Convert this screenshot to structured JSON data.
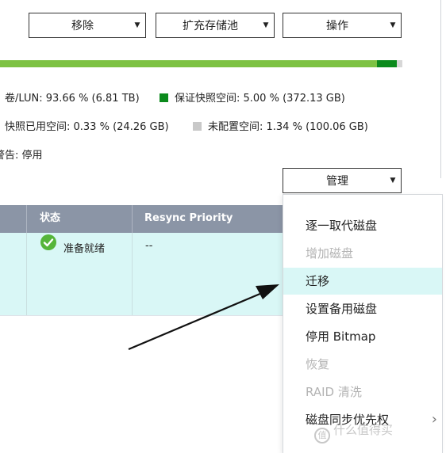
{
  "toolbar": {
    "remove_label": "移除",
    "expand_label": "扩充存储池",
    "actions_label": "操作"
  },
  "usage_bar": {
    "used_fraction": 0.9366,
    "snapshot_fraction": 0.05,
    "colors": {
      "used": "#7dc243",
      "snapshot": "#0b8a1c",
      "free": "#d7d7d7"
    }
  },
  "stats": {
    "volume_lun": "卷/LUN: 93.66 % (6.81 TB)",
    "guaranteed_snapshot": "保证快照空间: 5.00 % (372.13 GB)",
    "snapshot_used": "快照已用空间: 0.33 % (24.26 GB)",
    "unallocated": "未配置空间: 1.34 % (100.06 GB)",
    "warning": "警告: 停用"
  },
  "manage_button": {
    "label": "管理"
  },
  "table": {
    "headers": {
      "status": "状态",
      "resync": "Resync Priority"
    },
    "rows": [
      {
        "status": "准备就绪",
        "resync": "--"
      }
    ]
  },
  "menu": {
    "items": [
      {
        "label": "逐一取代磁盘",
        "disabled": false
      },
      {
        "label": "增加磁盘",
        "disabled": true
      },
      {
        "label": "迁移",
        "disabled": false,
        "highlighted": true
      },
      {
        "label": "设置备用磁盘",
        "disabled": false
      },
      {
        "label": "停用 Bitmap",
        "disabled": false
      },
      {
        "label": "恢复",
        "disabled": true
      },
      {
        "label": "RAID 清洗",
        "disabled": true
      },
      {
        "label": "磁盘同步优先权",
        "disabled": false,
        "submenu": true
      }
    ]
  },
  "watermark": {
    "text": "什么值得买",
    "logo": "值"
  },
  "icons": {
    "status": "check-circle-icon",
    "caret": "caret-down-icon",
    "submenu": "chevron-right-icon"
  },
  "colors": {
    "accent": "#7dc243",
    "header": "#8b95a6",
    "highlight": "#d9f7f6",
    "ok": "#55b53a"
  }
}
